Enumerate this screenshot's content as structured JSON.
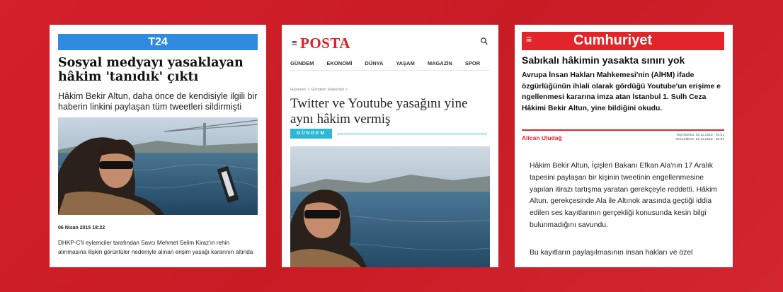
{
  "t24": {
    "brand": "T24",
    "title": "Sosyal medyayı yasaklayan hâkim 'tanıdık' çıktı",
    "subtitle": "Hâkim Bekir Altun, daha önce de kendisiyle ilgili bir haberin linkini paylaşan tüm tweetleri sildirmişti",
    "date": "06 Nisan 2015 18:22",
    "body": "DHKP-C'li eylemciler tarafından Savcı Mehmet Selim Kiraz'ın rehin alınmasına ilişkin görüntüler nedeniyle alınan erişim yasağı kararının altında"
  },
  "posta": {
    "menu_icon": "≡",
    "logo": "POSTA",
    "search_icon": "⌕",
    "nav": [
      "GÜNDEM",
      "EKONOMİ",
      "DÜNYA",
      "YAŞAM",
      "MAGAZİN",
      "SPOR"
    ],
    "breadcrumb": "Haberler > Gündem Haberleri >",
    "title": "Twitter ve Youtube yasağını yine aynı hâkim vermiş",
    "tag": "GÜNDEM"
  },
  "cumhuriyet": {
    "menu_icon": "≡",
    "logo": "Cumhuriyet",
    "title": "Sabıkalı hâkimin yasakta sınırı yok",
    "lead": "Avrupa İnsan Hakları Mahkemesi'nin (AİHM) ifade özgürlüğünün ihlali olarak gördüğü Youtube'un erişime e ngellenmesi kararına imza atan İstanbul 1. Sulh Ceza Hâkimi Bekir Altun, yine bildiğini okudu.",
    "author": "Alican Uludağ",
    "published": "Yayınlanma: 03.12.2015 - 01:01",
    "updated": "Güncelleme: 03.12.2015 - 03:52",
    "body": "Hâkim Bekir Altun, İçişleri Bakanı Efkan Ala'nın 17 Aralık tapesini paylaşan bir kişinin tweetinin engellenmesine yapılan itirazı tartışma yaratan gerekçeyle reddetti. Hâkim Altun, gerekçesinde Ala ile Altınok arasında geçtiği iddia edilen ses kayıtlarının gerçekliği konusunda kesin bilgi bulunmadığını savundu.",
    "body2": "Bu kayıtların paylaşılmasının insan hakları ve özel"
  },
  "colors": {
    "background": "#d3202a",
    "t24_blue": "#2f8ae0",
    "posta_red": "#e31e24",
    "posta_tag": "#2cb6d8",
    "cumhuriyet_red": "#e3242b"
  }
}
